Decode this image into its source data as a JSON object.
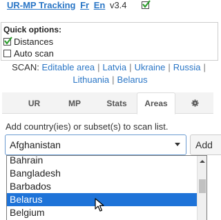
{
  "header": {
    "title": "UR-MP Tracking",
    "lang_fr": "Fr",
    "lang_en": "En",
    "version": "v3.4",
    "enabled_checked": true
  },
  "quick_options": {
    "title": "Quick options:",
    "distances_label": "Distances",
    "distances_checked": true,
    "autoscan_label": "Auto scan",
    "autoscan_checked": false
  },
  "scan": {
    "label": "SCAN:",
    "links": [
      "Editable area",
      "Latvia",
      "Ukraine",
      "Russia",
      "Lithuania",
      "Belarus"
    ]
  },
  "tabs": [
    {
      "label": "UR",
      "active": false
    },
    {
      "label": "MP",
      "active": false
    },
    {
      "label": "Stats",
      "active": false
    },
    {
      "label": "Areas",
      "active": true
    },
    {
      "label": "gear-icon",
      "active": false
    }
  ],
  "areas": {
    "instruction": "Add country(ies) or subset(s) to scan list.",
    "selected_value": "Afghanistan",
    "add_label": "Add",
    "options": [
      "Bahrain",
      "Bangladesh",
      "Barbados",
      "Belarus",
      "Belgium"
    ],
    "highlighted_option": "Belarus"
  },
  "colors": {
    "link": "#2a76c6",
    "check_green": "#2e9e2e",
    "highlight": "#1e73d8"
  }
}
